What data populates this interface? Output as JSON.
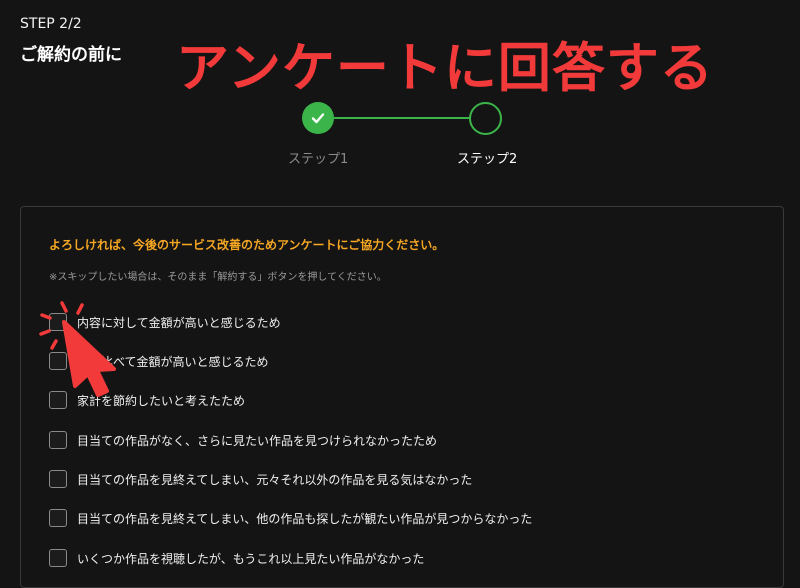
{
  "header": {
    "step_indicator": "STEP 2/2",
    "title": "ご解約の前に",
    "caption": "アンケートに回答する"
  },
  "stepper": {
    "steps": [
      {
        "label": "ステップ1",
        "status": "complete"
      },
      {
        "label": "ステップ2",
        "status": "current"
      }
    ]
  },
  "survey": {
    "prompt": "よろしければ、今後のサービス改善のためアンケートにご協力ください。",
    "note": "※スキップしたい場合は、そのまま「解約する」ボタンを押してください。",
    "options": [
      {
        "label": "内容に対して金額が高いと感じるため",
        "checked": false
      },
      {
        "label": "他と比べて金額が高いと感じるため",
        "checked": false
      },
      {
        "label": "家計を節約したいと考えたため",
        "checked": false
      },
      {
        "label": "目当ての作品がなく、さらに見たい作品を見つけられなかったため",
        "checked": false
      },
      {
        "label": "目当ての作品を見終えてしまい、元々それ以外の作品を見る気はなかった",
        "checked": false
      },
      {
        "label": "目当ての作品を見終えてしまい、他の作品も探したが観たい作品が見つからなかった",
        "checked": false
      },
      {
        "label": "いくつか作品を視聴したが、もうこれ以上見たい作品がなかった",
        "checked": false
      }
    ]
  },
  "colors": {
    "background": "#141414",
    "accent_green": "#3bb54a",
    "prompt_orange": "#f5a623",
    "caption_red": "#f23a3a"
  }
}
